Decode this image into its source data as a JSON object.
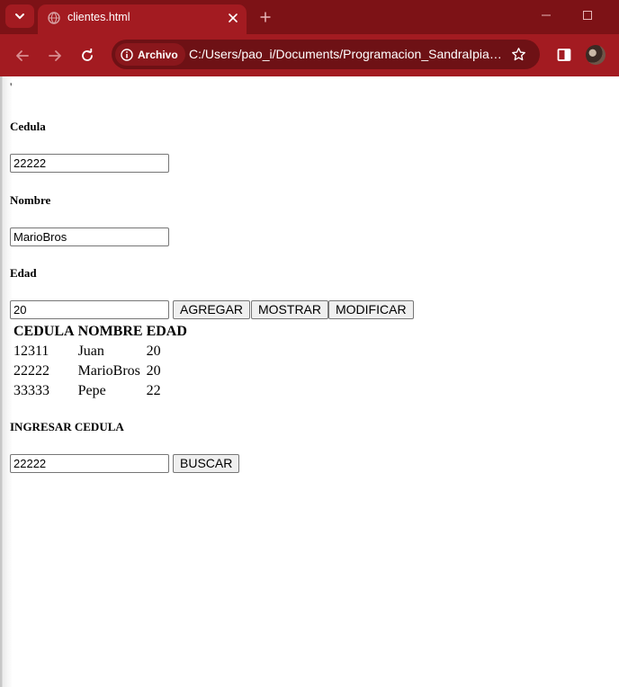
{
  "browser": {
    "tab": {
      "title": "clientes.html"
    },
    "chip_label": "Archivo",
    "url": "C:/Users/pao_i/Documents/Programacion_SandraIpiales.../clientes.html",
    "theme_color": "#a31b21",
    "frame_color": "#7d1216"
  },
  "page": {
    "stray_mark": "'",
    "cedula_label": "Cedula",
    "cedula_value": "22222",
    "nombre_label": "Nombre",
    "nombre_value": "MarioBros",
    "edad_label": "Edad",
    "edad_value": "20",
    "buttons": {
      "agregar": "AGREGAR",
      "mostrar": "MOSTRAR",
      "modificar": "MODIFICAR",
      "buscar": "BUSCAR"
    },
    "table": {
      "headers": [
        "CEDULA",
        "NOMBRE",
        "EDAD"
      ],
      "rows": [
        [
          "12311",
          "Juan",
          "20"
        ],
        [
          "22222",
          "MarioBros",
          "20"
        ],
        [
          "33333",
          "Pepe",
          "22"
        ]
      ]
    },
    "search_label": "INGRESAR CEDULA",
    "search_value": "22222"
  },
  "icons": [
    "tab-search-icon",
    "globe-icon",
    "close-icon",
    "plus-icon",
    "minimize-icon",
    "maximize-icon",
    "back-arrow-icon",
    "forward-arrow-icon",
    "reload-icon",
    "info-icon",
    "star-icon",
    "side-panel-icon",
    "avatar"
  ]
}
